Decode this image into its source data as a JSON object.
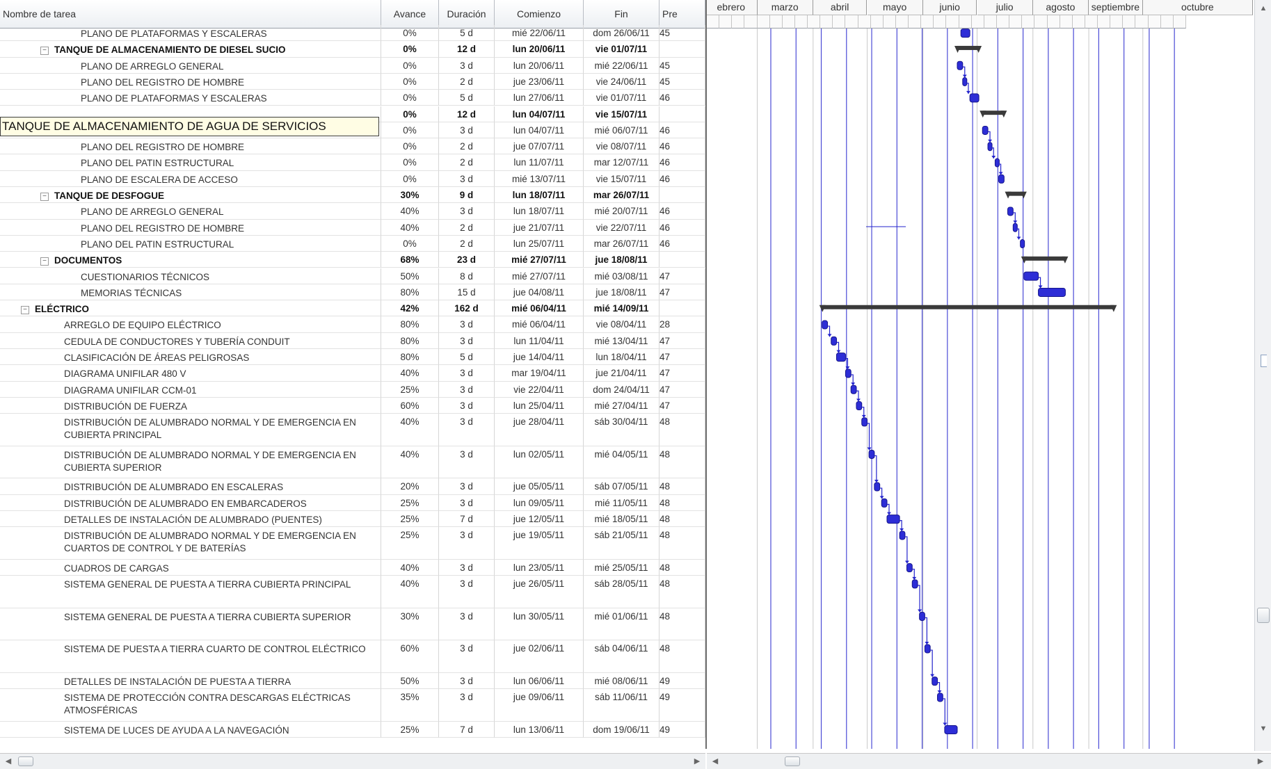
{
  "columns": {
    "name": "Nombre de tarea",
    "progress": "Avance",
    "duration": "Duración",
    "start": "Comienzo",
    "end": "Fin",
    "pred": "Pre"
  },
  "editing_cell": "TANQUE DE ALMACENAMIENTO DE AGUA DE SERVICIOS",
  "months": [
    "ebrero",
    "marzo",
    "abril",
    "mayo",
    "junio",
    "julio",
    "agosto",
    "septiembre",
    "octubre"
  ],
  "timeline": {
    "start": "2011-02-01",
    "months_start": [
      "2011-02-01",
      "2011-03-01",
      "2011-04-01",
      "2011-05-01",
      "2011-06-01",
      "2011-07-01",
      "2011-08-01",
      "2011-09-01",
      "2011-10-01"
    ]
  },
  "rows": [
    {
      "name": "PLANO DE PLATAFORMAS Y ESCALERAS",
      "progress": "0%",
      "duration": "5 d",
      "start": "mié 22/06/11",
      "end": "dom 26/06/11",
      "pred": "45",
      "level": 3,
      "summary": false,
      "s": "2011-06-22",
      "e": "2011-06-26",
      "lines": 1
    },
    {
      "name": "TANQUE DE ALMACENAMIENTO DE DIESEL SUCIO",
      "progress": "0%",
      "duration": "12 d",
      "start": "lun 20/06/11",
      "end": "vie 01/07/11",
      "pred": "",
      "level": 2,
      "summary": true,
      "s": "2011-06-20",
      "e": "2011-07-01",
      "lines": 1
    },
    {
      "name": "PLANO DE ARREGLO GENERAL",
      "progress": "0%",
      "duration": "3 d",
      "start": "lun 20/06/11",
      "end": "mié 22/06/11",
      "pred": "45",
      "level": 3,
      "summary": false,
      "s": "2011-06-20",
      "e": "2011-06-22",
      "lines": 1
    },
    {
      "name": "PLANO DEL REGISTRO DE HOMBRE",
      "progress": "0%",
      "duration": "2 d",
      "start": "jue 23/06/11",
      "end": "vie 24/06/11",
      "pred": "45",
      "level": 3,
      "summary": false,
      "s": "2011-06-23",
      "e": "2011-06-24",
      "lines": 1
    },
    {
      "name": "PLANO DE PLATAFORMAS Y ESCALERAS",
      "progress": "0%",
      "duration": "5 d",
      "start": "lun 27/06/11",
      "end": "vie 01/07/11",
      "pred": "46",
      "level": 3,
      "summary": false,
      "s": "2011-06-27",
      "e": "2011-07-01",
      "lines": 1
    },
    {
      "name": "",
      "progress": "0%",
      "duration": "12 d",
      "start": "lun 04/07/11",
      "end": "vie 15/07/11",
      "pred": "",
      "level": 2,
      "summary": true,
      "s": "2011-07-04",
      "e": "2011-07-15",
      "lines": 1,
      "editing": true
    },
    {
      "name": "PLANO DE ARREGLO GENERAL",
      "progress": "0%",
      "duration": "3 d",
      "start": "lun 04/07/11",
      "end": "mié 06/07/11",
      "pred": "46",
      "level": 3,
      "summary": false,
      "s": "2011-07-04",
      "e": "2011-07-06",
      "lines": 1
    },
    {
      "name": "PLANO DEL REGISTRO DE HOMBRE",
      "progress": "0%",
      "duration": "2 d",
      "start": "jue 07/07/11",
      "end": "vie 08/07/11",
      "pred": "46",
      "level": 3,
      "summary": false,
      "s": "2011-07-07",
      "e": "2011-07-08",
      "lines": 1
    },
    {
      "name": "PLANO DEL PATIN ESTRUCTURAL",
      "progress": "0%",
      "duration": "2 d",
      "start": "lun 11/07/11",
      "end": "mar 12/07/11",
      "pred": "46",
      "level": 3,
      "summary": false,
      "s": "2011-07-11",
      "e": "2011-07-12",
      "lines": 1
    },
    {
      "name": "PLANO DE ESCALERA DE ACCESO",
      "progress": "0%",
      "duration": "3 d",
      "start": "mié 13/07/11",
      "end": "vie 15/07/11",
      "pred": "46",
      "level": 3,
      "summary": false,
      "s": "2011-07-13",
      "e": "2011-07-15",
      "lines": 1
    },
    {
      "name": "TANQUE DE DESFOGUE",
      "progress": "30%",
      "duration": "9 d",
      "start": "lun 18/07/11",
      "end": "mar 26/07/11",
      "pred": "",
      "level": 2,
      "summary": true,
      "s": "2011-07-18",
      "e": "2011-07-26",
      "lines": 1
    },
    {
      "name": "PLANO DE ARREGLO GENERAL",
      "progress": "40%",
      "duration": "3 d",
      "start": "lun 18/07/11",
      "end": "mié 20/07/11",
      "pred": "46",
      "level": 3,
      "summary": false,
      "s": "2011-07-18",
      "e": "2011-07-20",
      "lines": 1
    },
    {
      "name": "PLANO DEL REGISTRO DE HOMBRE",
      "progress": "40%",
      "duration": "2 d",
      "start": "jue 21/07/11",
      "end": "vie 22/07/11",
      "pred": "46",
      "level": 3,
      "summary": false,
      "s": "2011-07-21",
      "e": "2011-07-22",
      "lines": 1
    },
    {
      "name": "PLANO DEL PATIN ESTRUCTURAL",
      "progress": "0%",
      "duration": "2 d",
      "start": "lun 25/07/11",
      "end": "mar 26/07/11",
      "pred": "46",
      "level": 3,
      "summary": false,
      "s": "2011-07-25",
      "e": "2011-07-26",
      "lines": 1
    },
    {
      "name": "DOCUMENTOS",
      "progress": "68%",
      "duration": "23 d",
      "start": "mié 27/07/11",
      "end": "jue 18/08/11",
      "pred": "",
      "level": 2,
      "summary": true,
      "s": "2011-07-27",
      "e": "2011-08-18",
      "lines": 1
    },
    {
      "name": "CUESTIONARIOS TÉCNICOS",
      "progress": "50%",
      "duration": "8 d",
      "start": "mié 27/07/11",
      "end": "mié 03/08/11",
      "pred": "47",
      "level": 3,
      "summary": false,
      "s": "2011-07-27",
      "e": "2011-08-03",
      "lines": 1
    },
    {
      "name": "MEMORIAS TÉCNICAS",
      "progress": "80%",
      "duration": "15 d",
      "start": "jue 04/08/11",
      "end": "jue 18/08/11",
      "pred": "47",
      "level": 3,
      "summary": false,
      "s": "2011-08-04",
      "e": "2011-08-18",
      "lines": 1
    },
    {
      "name": "ELÉCTRICO",
      "progress": "42%",
      "duration": "162 d",
      "start": "mié 06/04/11",
      "end": "mié 14/09/11",
      "pred": "",
      "level": 1,
      "summary": true,
      "s": "2011-04-06",
      "e": "2011-09-14",
      "lines": 1
    },
    {
      "name": "ARREGLO DE EQUIPO ELÉCTRICO",
      "progress": "80%",
      "duration": "3 d",
      "start": "mié 06/04/11",
      "end": "vie 08/04/11",
      "pred": "28",
      "level": 2,
      "summary": false,
      "s": "2011-04-06",
      "e": "2011-04-08",
      "lines": 1
    },
    {
      "name": "CEDULA DE CONDUCTORES Y TUBERÍA CONDUIT",
      "progress": "80%",
      "duration": "3 d",
      "start": "lun 11/04/11",
      "end": "mié 13/04/11",
      "pred": "47",
      "level": 2,
      "summary": false,
      "s": "2011-04-11",
      "e": "2011-04-13",
      "lines": 1
    },
    {
      "name": "CLASIFICACIÓN DE ÁREAS PELIGROSAS",
      "progress": "80%",
      "duration": "5 d",
      "start": "jue 14/04/11",
      "end": "lun 18/04/11",
      "pred": "47",
      "level": 2,
      "summary": false,
      "s": "2011-04-14",
      "e": "2011-04-18",
      "lines": 1
    },
    {
      "name": "DIAGRAMA UNIFILAR 480 V",
      "progress": "40%",
      "duration": "3 d",
      "start": "mar 19/04/11",
      "end": "jue 21/04/11",
      "pred": "47",
      "level": 2,
      "summary": false,
      "s": "2011-04-19",
      "e": "2011-04-21",
      "lines": 1
    },
    {
      "name": "DIAGRAMA UNIFILAR CCM-01",
      "progress": "25%",
      "duration": "3 d",
      "start": "vie 22/04/11",
      "end": "dom 24/04/11",
      "pred": "47",
      "level": 2,
      "summary": false,
      "s": "2011-04-22",
      "e": "2011-04-24",
      "lines": 1
    },
    {
      "name": "DISTRIBUCIÓN DE FUERZA",
      "progress": "60%",
      "duration": "3 d",
      "start": "lun 25/04/11",
      "end": "mié 27/04/11",
      "pred": "47",
      "level": 2,
      "summary": false,
      "s": "2011-04-25",
      "e": "2011-04-27",
      "lines": 1
    },
    {
      "name": "DISTRIBUCIÓN DE ALUMBRADO NORMAL Y DE EMERGENCIA EN CUBIERTA PRINCIPAL",
      "progress": "40%",
      "duration": "3 d",
      "start": "jue 28/04/11",
      "end": "sáb 30/04/11",
      "pred": "48",
      "level": 2,
      "summary": false,
      "s": "2011-04-28",
      "e": "2011-04-30",
      "lines": 2
    },
    {
      "name": "DISTRIBUCIÓN DE ALUMBRADO NORMAL Y DE EMERGENCIA EN CUBIERTA SUPERIOR",
      "progress": "40%",
      "duration": "3 d",
      "start": "lun 02/05/11",
      "end": "mié 04/05/11",
      "pred": "48",
      "level": 2,
      "summary": false,
      "s": "2011-05-02",
      "e": "2011-05-04",
      "lines": 2
    },
    {
      "name": "DISTRIBUCIÓN DE ALUMBRADO EN ESCALERAS",
      "progress": "20%",
      "duration": "3 d",
      "start": "jue 05/05/11",
      "end": "sáb 07/05/11",
      "pred": "48",
      "level": 2,
      "summary": false,
      "s": "2011-05-05",
      "e": "2011-05-07",
      "lines": 1
    },
    {
      "name": "DISTRIBUCIÓN DE ALUMBRADO EN EMBARCADEROS",
      "progress": "25%",
      "duration": "3 d",
      "start": "lun 09/05/11",
      "end": "mié 11/05/11",
      "pred": "48",
      "level": 2,
      "summary": false,
      "s": "2011-05-09",
      "e": "2011-05-11",
      "lines": 1
    },
    {
      "name": "DETALLES DE INSTALACIÓN DE ALUMBRADO (PUENTES)",
      "progress": "25%",
      "duration": "7 d",
      "start": "jue 12/05/11",
      "end": "mié 18/05/11",
      "pred": "48",
      "level": 2,
      "summary": false,
      "s": "2011-05-12",
      "e": "2011-05-18",
      "lines": 1
    },
    {
      "name": "DISTRIBUCIÓN DE ALUMBRADO NORMAL Y DE EMERGENCIA EN CUARTOS DE CONTROL Y DE BATERÍAS",
      "progress": "25%",
      "duration": "3 d",
      "start": "jue 19/05/11",
      "end": "sáb 21/05/11",
      "pred": "48",
      "level": 2,
      "summary": false,
      "s": "2011-05-19",
      "e": "2011-05-21",
      "lines": 2
    },
    {
      "name": "CUADROS DE CARGAS",
      "progress": "40%",
      "duration": "3 d",
      "start": "lun 23/05/11",
      "end": "mié 25/05/11",
      "pred": "48",
      "level": 2,
      "summary": false,
      "s": "2011-05-23",
      "e": "2011-05-25",
      "lines": 1
    },
    {
      "name": "SISTEMA GENERAL DE PUESTA A TIERRA CUBIERTA PRINCIPAL",
      "progress": "40%",
      "duration": "3 d",
      "start": "jue 26/05/11",
      "end": "sáb 28/05/11",
      "pred": "48",
      "level": 2,
      "summary": false,
      "s": "2011-05-26",
      "e": "2011-05-28",
      "lines": 2
    },
    {
      "name": "SISTEMA GENERAL DE PUESTA A TIERRA CUBIERTA SUPERIOR",
      "progress": "30%",
      "duration": "3 d",
      "start": "lun 30/05/11",
      "end": "mié 01/06/11",
      "pred": "48",
      "level": 2,
      "summary": false,
      "s": "2011-05-30",
      "e": "2011-06-01",
      "lines": 2
    },
    {
      "name": "SISTEMA DE PUESTA A TIERRA CUARTO DE CONTROL ELÉCTRICO",
      "progress": "60%",
      "duration": "3 d",
      "start": "jue 02/06/11",
      "end": "sáb 04/06/11",
      "pred": "48",
      "level": 2,
      "summary": false,
      "s": "2011-06-02",
      "e": "2011-06-04",
      "lines": 2
    },
    {
      "name": "DETALLES DE INSTALACIÓN DE PUESTA A TIERRA",
      "progress": "50%",
      "duration": "3 d",
      "start": "lun 06/06/11",
      "end": "mié 08/06/11",
      "pred": "49",
      "level": 2,
      "summary": false,
      "s": "2011-06-06",
      "e": "2011-06-08",
      "lines": 1
    },
    {
      "name": "SISTEMA DE PROTECCIÓN CONTRA DESCARGAS ELÉCTRICAS ATMOSFÉRICAS",
      "progress": "35%",
      "duration": "3 d",
      "start": "jue 09/06/11",
      "end": "sáb 11/06/11",
      "pred": "49",
      "level": 2,
      "summary": false,
      "s": "2011-06-09",
      "e": "2011-06-11",
      "lines": 2
    },
    {
      "name": "SISTEMA DE LUCES DE AYUDA A LA NAVEGACIÓN",
      "progress": "25%",
      "duration": "7 d",
      "start": "lun 13/06/11",
      "end": "dom 19/06/11",
      "pred": "49",
      "level": 2,
      "summary": false,
      "s": "2011-06-13",
      "e": "2011-06-19",
      "lines": 1
    }
  ],
  "colors": {
    "task_bar": "#2d2dd6",
    "summary_bar": "#3a3a3a",
    "link": "#2222cc",
    "grid_line": "#2b2bd0"
  },
  "icons": {
    "collapse": "minus-box-icon",
    "scroll_left": "arrow-left-icon",
    "scroll_right": "arrow-right-icon",
    "scroll_up": "arrow-up-icon"
  }
}
